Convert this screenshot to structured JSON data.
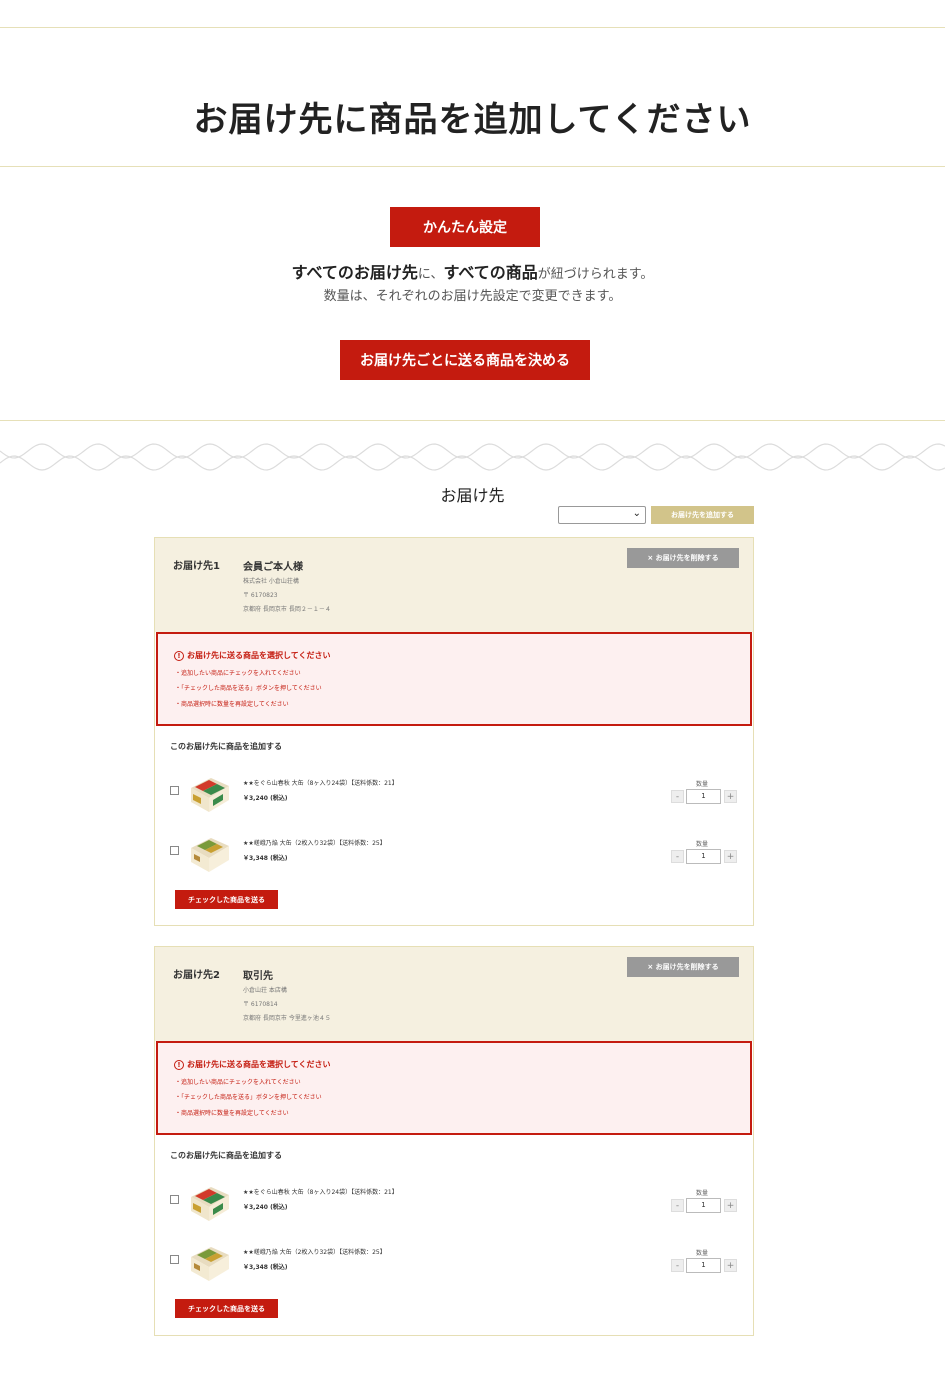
{
  "page_title": "お届け先に商品を追加してください",
  "easy_setup": {
    "button_label": "かんたん設定",
    "desc_bold_1": "すべてのお届け先",
    "desc_text_1": "に、",
    "desc_bold_2": "すべての商品",
    "desc_text_2": "が紐づけられます。",
    "desc_line2": "数量は、それぞれのお届け先設定で変更できます。"
  },
  "per_dest_button_label": "お届け先ごとに送る商品を決める",
  "destinations_section": {
    "title": "お届け先",
    "select_value": "",
    "add_button_label": "お届け先を追加する"
  },
  "colors": {
    "accent_red": "#c41b0f",
    "gold": "#d2c48a",
    "card_bg": "#f5f0e0"
  },
  "destinations": [
    {
      "label": "お届け先1",
      "name": "会員ご本人様",
      "company": "株式会社 小倉山荘構",
      "zip": "〒 6170823",
      "address": "京都府 長岡京市 長岡２－１－４",
      "delete_label": "× お届け先を削除する",
      "warning": {
        "title": "お届け先に送る商品を選択してください",
        "items": [
          "・追加したい商品にチェックを入れてください",
          "・「チェックした商品を送る」ボタンを押してください",
          "・商品選択時に数量を再設定してください"
        ]
      },
      "add_title": "このお届け先に商品を追加する",
      "products": [
        {
          "name": "★★をぐら山春秋 大缶（8ヶ入り24袋）【送料係数：21】",
          "price": "￥3,240 (税込)",
          "qty_label": "数量",
          "qty": "1"
        },
        {
          "name": "★★嵯峨乃焔 大缶（2枚入り32袋）【送料係数：25】",
          "price": "￥3,348 (税込)",
          "qty_label": "数量",
          "qty": "1"
        }
      ],
      "send_label": "チェックした商品を送る"
    },
    {
      "label": "お届け先2",
      "name": "取引先",
      "company": "小倉山荘 本店構",
      "zip": "〒 6170814",
      "address": "京都府 長岡京市 今里進ヶ池４５",
      "delete_label": "× お届け先を削除する",
      "warning": {
        "title": "お届け先に送る商品を選択してください",
        "items": [
          "・追加したい商品にチェックを入れてください",
          "・「チェックした商品を送る」ボタンを押してください",
          "・商品選択時に数量を再設定してください"
        ]
      },
      "add_title": "このお届け先に商品を追加する",
      "products": [
        {
          "name": "★★をぐら山春秋 大缶（8ヶ入り24袋）【送料係数：21】",
          "price": "￥3,240 (税込)",
          "qty_label": "数量",
          "qty": "1"
        },
        {
          "name": "★★嵯峨乃焔 大缶（2枚入り32袋）【送料係数：25】",
          "price": "￥3,348 (税込)",
          "qty_label": "数量",
          "qty": "1"
        }
      ],
      "send_label": "チェックした商品を送る"
    }
  ]
}
